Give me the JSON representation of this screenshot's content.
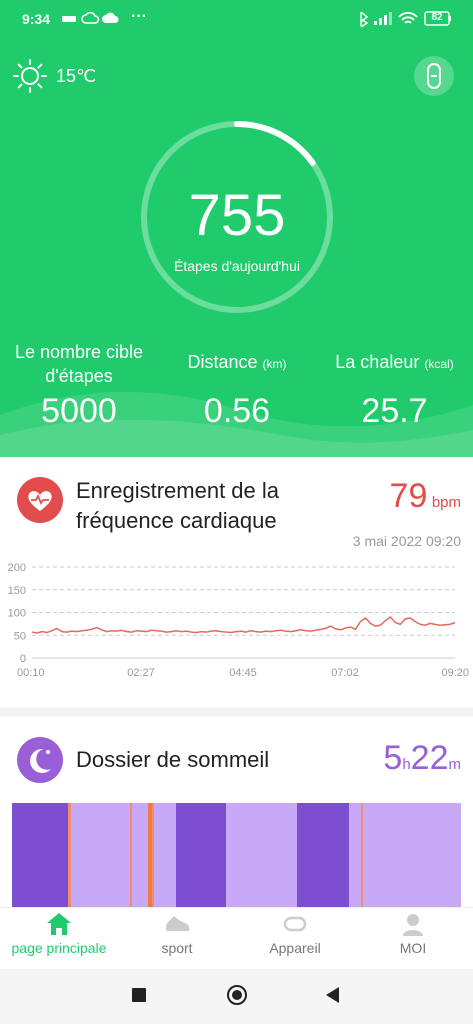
{
  "status_bar": {
    "time": "9:34",
    "more": "···",
    "battery": "82"
  },
  "weather": {
    "temperature": "15℃"
  },
  "steps": {
    "count": "755",
    "label": "Étapes d'aujourd'hui",
    "progress": 0.151
  },
  "stats": [
    {
      "label": "Le nombre cible",
      "label2": "d'étapes",
      "unit": "",
      "value": "5000"
    },
    {
      "label": "Distance",
      "label2": "",
      "unit": "(km)",
      "value": "0.56"
    },
    {
      "label": "La chaleur",
      "label2": "",
      "unit": "(kcal)",
      "value": "25.7"
    }
  ],
  "heart": {
    "title_line1": "Enregistrement de la",
    "title_line2": "fréquence cardiaque",
    "value": "79",
    "unit": "bpm",
    "date": "3 mai 2022 09:20"
  },
  "chart_data": {
    "type": "line",
    "y_ticks": [
      "200",
      "150",
      "100",
      "50",
      "0"
    ],
    "x_ticks": [
      "00:10",
      "02:27",
      "04:45",
      "07:02",
      "09:20"
    ],
    "ylim": [
      0,
      200
    ],
    "grid": "dashed horizontal",
    "series": [
      {
        "color": "#e56a5a",
        "values": [
          57,
          55,
          58,
          56,
          60,
          65,
          58,
          57,
          59,
          58,
          60,
          61,
          63,
          67,
          62,
          58,
          60,
          59,
          61,
          58,
          57,
          60,
          59,
          58,
          61,
          60,
          59,
          57,
          58,
          60,
          58,
          59,
          57,
          56,
          58,
          57,
          59,
          60,
          58,
          57,
          56,
          58,
          59,
          57,
          60,
          58,
          57,
          59,
          58,
          60,
          61,
          59,
          58,
          60,
          62,
          60,
          59,
          61,
          63,
          65,
          70,
          64,
          62,
          66,
          68,
          63,
          80,
          88,
          76,
          70,
          72,
          82,
          90,
          78,
          74,
          86,
          88,
          80,
          74,
          72,
          76,
          74,
          72,
          73,
          74,
          78
        ]
      }
    ]
  },
  "sleep": {
    "title": "Dossier de sommeil",
    "hours": "5",
    "h_unit": "h",
    "minutes": "22",
    "m_unit": "m"
  },
  "tabs": [
    {
      "label": "page principale",
      "icon": "home-icon"
    },
    {
      "label": "sport",
      "icon": "shoe-icon"
    },
    {
      "label": "Appareil",
      "icon": "watch-icon"
    },
    {
      "label": "MOI",
      "icon": "person-icon"
    }
  ],
  "colors": {
    "green": "#1fcb6b",
    "heart_red": "#e24c4c",
    "sleep_purple": "#9a5fd6",
    "deep_sleep": "#7b4fcf",
    "light_sleep": "#c8a9f7",
    "awake": "#ef8a73"
  }
}
